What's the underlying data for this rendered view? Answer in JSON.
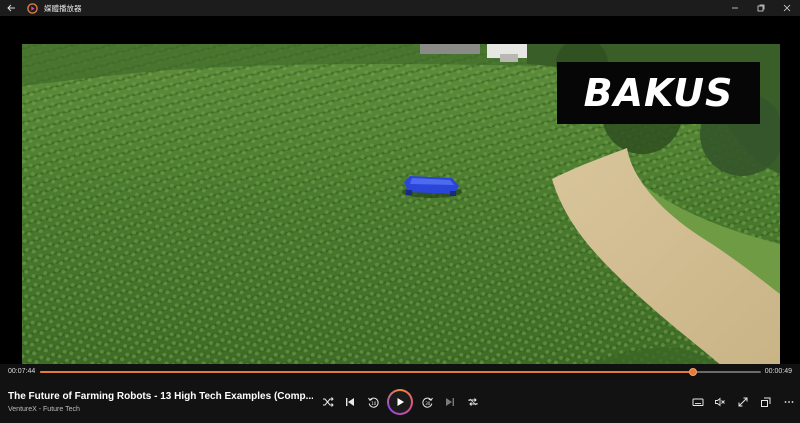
{
  "window": {
    "title": "媒體播放器",
    "back_icon": "back-arrow-icon",
    "app_icon": "media-player-logo-icon",
    "buttons": [
      "minimize-icon",
      "maximize-icon",
      "close-icon"
    ]
  },
  "video": {
    "overlay_text": "BAKUS"
  },
  "playback": {
    "current_time": "00:07:44",
    "remaining_time": "00:00:49",
    "progress_fraction": 0.905
  },
  "media": {
    "title": "The Future of Farming Robots - 13 High Tech Examples (Comp...",
    "subtitle": "VentureX - Future Tech"
  },
  "controls": {
    "left": [
      "shuffle-icon",
      "previous-icon",
      "rewind-10-icon",
      "play-icon",
      "forward-30-icon",
      "next-icon",
      "repeat-icon"
    ],
    "right": [
      "subtitles-icon",
      "volume-mute-icon",
      "fullscreen-icon",
      "mini-player-icon",
      "more-icon"
    ]
  },
  "colors": {
    "accent": "#e37b3a",
    "titlebar": "#1c1c1c",
    "controls_bg": "#121212"
  }
}
